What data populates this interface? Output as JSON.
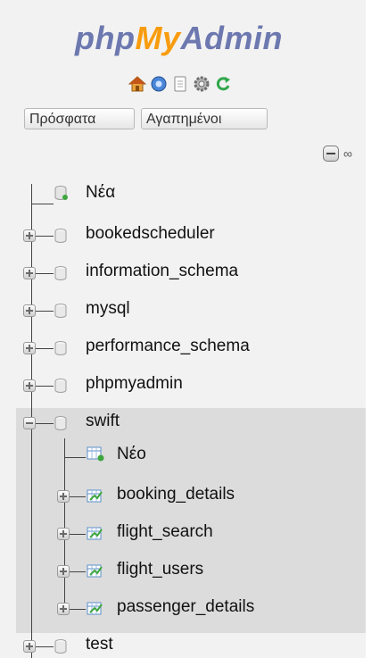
{
  "logo": {
    "part1": "php",
    "part2": "My",
    "part3": "Admin"
  },
  "toolbar_icons": [
    "home-icon",
    "docs-icon",
    "sql-docs-icon",
    "settings-icon",
    "reload-icon"
  ],
  "tabs": {
    "recent": "Πρόσφατα",
    "favorites": "Αγαπημένοι"
  },
  "tree": {
    "new_database": "Νέα",
    "databases": [
      "bookedscheduler",
      "information_schema",
      "mysql",
      "performance_schema",
      "phpmyadmin",
      "swift",
      "test"
    ],
    "expanded": {
      "new_table": "Νέο",
      "tables": [
        "booking_details",
        "flight_search",
        "flight_users",
        "passenger_details"
      ]
    }
  },
  "colors": {
    "panel_bg": "#f2f2f2",
    "selected_bg": "#dcdcdc",
    "logo_blue": "#6c78af",
    "logo_orange": "#f89c0e"
  }
}
